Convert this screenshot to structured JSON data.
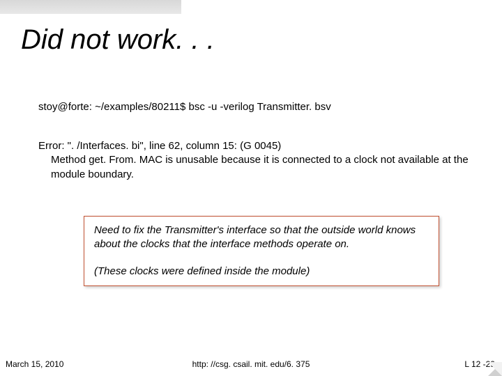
{
  "title": "Did not work. . .",
  "cmd": "stoy@forte: ~/examples/80211$ bsc -u -verilog Transmitter. bsv",
  "error": {
    "line1": "Error: \". /Interfaces. bi\", line 62, column 15: (G 0045)",
    "line2": "Method get. From. MAC is unusable because it is connected to a clock not available at the module boundary."
  },
  "note": {
    "para1": "Need to fix the Transmitter's interface so that the outside world knows about the clocks that the interface methods operate on.",
    "para2": "(These clocks were defined inside the module)"
  },
  "footer": {
    "date": "March 15, 2010",
    "url": "http: //csg. csail. mit. edu/6. 375",
    "page": "L 12 -29"
  }
}
